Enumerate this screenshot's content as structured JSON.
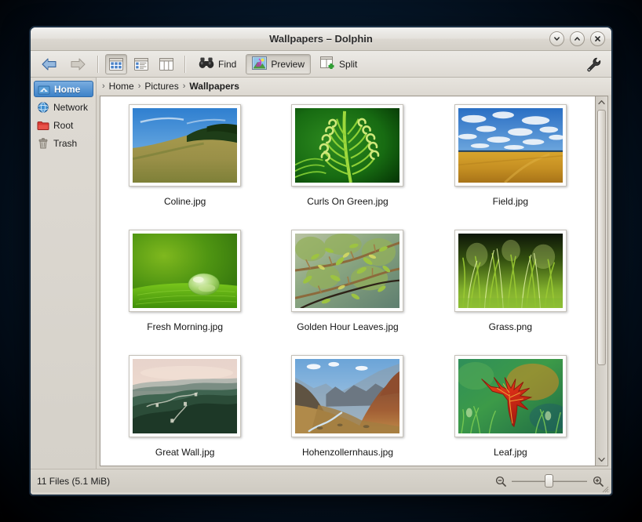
{
  "window": {
    "title": "Wallpapers – Dolphin",
    "controls": [
      {
        "name": "minimize-button",
        "icon": "chevron-down-icon"
      },
      {
        "name": "maximize-button",
        "icon": "chevron-up-icon"
      },
      {
        "name": "close-button",
        "icon": "close-icon"
      }
    ]
  },
  "toolbar": {
    "back_label": "Back",
    "forward_label": "Forward",
    "view_icons_label": "Icons",
    "view_details_label": "Details",
    "view_columns_label": "Columns",
    "find_label": "Find",
    "preview_label": "Preview",
    "split_label": "Split",
    "configure_label": "Configure",
    "active_view": "icons",
    "preview_active": true
  },
  "sidebar": {
    "items": [
      {
        "label": "Home",
        "icon": "home-folder-icon",
        "selected": true
      },
      {
        "label": "Network",
        "icon": "network-globe-icon",
        "selected": false
      },
      {
        "label": "Root",
        "icon": "red-folder-icon",
        "selected": false
      },
      {
        "label": "Trash",
        "icon": "trash-icon",
        "selected": false
      }
    ]
  },
  "breadcrumb": {
    "separator": "›",
    "items": [
      {
        "label": "Home",
        "current": false
      },
      {
        "label": "Pictures",
        "current": false
      },
      {
        "label": "Wallpapers",
        "current": true
      }
    ]
  },
  "files": [
    {
      "name": "Coline.jpg",
      "thumb": "coline"
    },
    {
      "name": "Curls On Green.jpg",
      "thumb": "curls"
    },
    {
      "name": "Field.jpg",
      "thumb": "field"
    },
    {
      "name": "Fresh Morning.jpg",
      "thumb": "freshmorning"
    },
    {
      "name": "Golden Hour Leaves.jpg",
      "thumb": "golden"
    },
    {
      "name": "Grass.png",
      "thumb": "grass"
    },
    {
      "name": "Great Wall.jpg",
      "thumb": "greatwall"
    },
    {
      "name": "Hohenzollernhaus.jpg",
      "thumb": "hohen"
    },
    {
      "name": "Leaf.jpg",
      "thumb": "leaf"
    }
  ],
  "statusbar": {
    "text": "11 Files (5.1 MiB)",
    "zoom_out_icon": "zoom-out-icon",
    "zoom_in_icon": "zoom-in-icon"
  },
  "colors": {
    "selection_blue": "#3d82c8",
    "window_chrome": "#d8d4cc",
    "desktop": "#0d2b4a"
  }
}
